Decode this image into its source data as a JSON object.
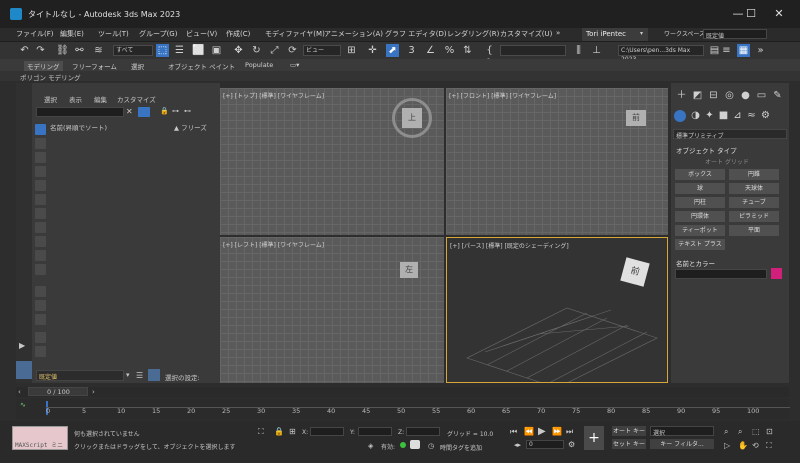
{
  "window": {
    "title": "タイトルなし - Autodesk 3ds Max 2023",
    "minimize": "—",
    "maximize": "☐",
    "close": "✕"
  },
  "menu": {
    "items": [
      "ファイル(F)",
      "編集(E)",
      "ツール(T)",
      "グループ(G)",
      "ビュー(V)",
      "作成(C)",
      "モディファイヤ(M)",
      "アニメーション(A)",
      "グラフ エディタ(D)",
      "レンダリング(R)",
      "カスタマイズ(U)",
      "»"
    ],
    "user": "Tori iPentec",
    "workspace_label": "ワークスペース:",
    "workspace_value": "既定値"
  },
  "toolbar": {
    "selection_filter": "すべて",
    "view": "ビュー",
    "path": "C:\\Users\\pen...3ds Max 2023"
  },
  "ribbon": {
    "tabs": [
      "モデリング",
      "フリーフォーム",
      "選択",
      "オブジェクト ペイント",
      "Populate"
    ],
    "sub": "ポリゴン モデリング"
  },
  "scene_explorer": {
    "menu": [
      "選択",
      "表示",
      "編集",
      "カスタマイズ"
    ],
    "col_name": "名前(昇順でソート)",
    "col_freeze": "▲ フリーズ",
    "layer": "既定値",
    "selection_setting": "選択の設定:"
  },
  "viewports": [
    {
      "label": "[+] [トップ] [標準] [ワイヤフレーム]",
      "cube": "上"
    },
    {
      "label": "[+] [フロント] [標準] [ワイヤフレーム]",
      "cube": "前"
    },
    {
      "label": "[+] [レフト] [標準] [ワイヤフレーム]",
      "cube": "左"
    },
    {
      "label": "[+] [パース] [標準] [既定のシェーディング]",
      "cube": "前"
    }
  ],
  "command_panel": {
    "category": "標準プリミティブ",
    "object_type": "オブジェクト タイプ",
    "auto_grid": "オート グリッド",
    "buttons": [
      "ボックス",
      "円錐",
      "球",
      "天球体",
      "円柱",
      "チューブ",
      "円環体",
      "ピラミッド",
      "ティーポット",
      "平面",
      "テキスト プラス"
    ],
    "name_color": "名前とカラー",
    "swatch_color": "#d0207c"
  },
  "timeline": {
    "frame": "0 / 100",
    "ticks": [
      "0",
      "5",
      "10",
      "15",
      "20",
      "25",
      "30",
      "35",
      "40",
      "45",
      "50",
      "55",
      "60",
      "65",
      "70",
      "75",
      "80",
      "85",
      "90",
      "95",
      "100"
    ]
  },
  "status": {
    "maxscript": "MAXScript ミニ",
    "msg1": "何も選択されていません",
    "msg2": "クリックまたはドラッグをして、オブジェクトを選択します",
    "x": "X:",
    "y": "Y:",
    "z": "Z:",
    "grid": "グリッド = 10.0",
    "enabled": "有効:",
    "add_tag": "時間タグを追加",
    "auto_key": "オート キー",
    "set_key": "セット キー",
    "select": "選択",
    "key_filter": "キー フィルタ...",
    "frame_field": "0"
  }
}
